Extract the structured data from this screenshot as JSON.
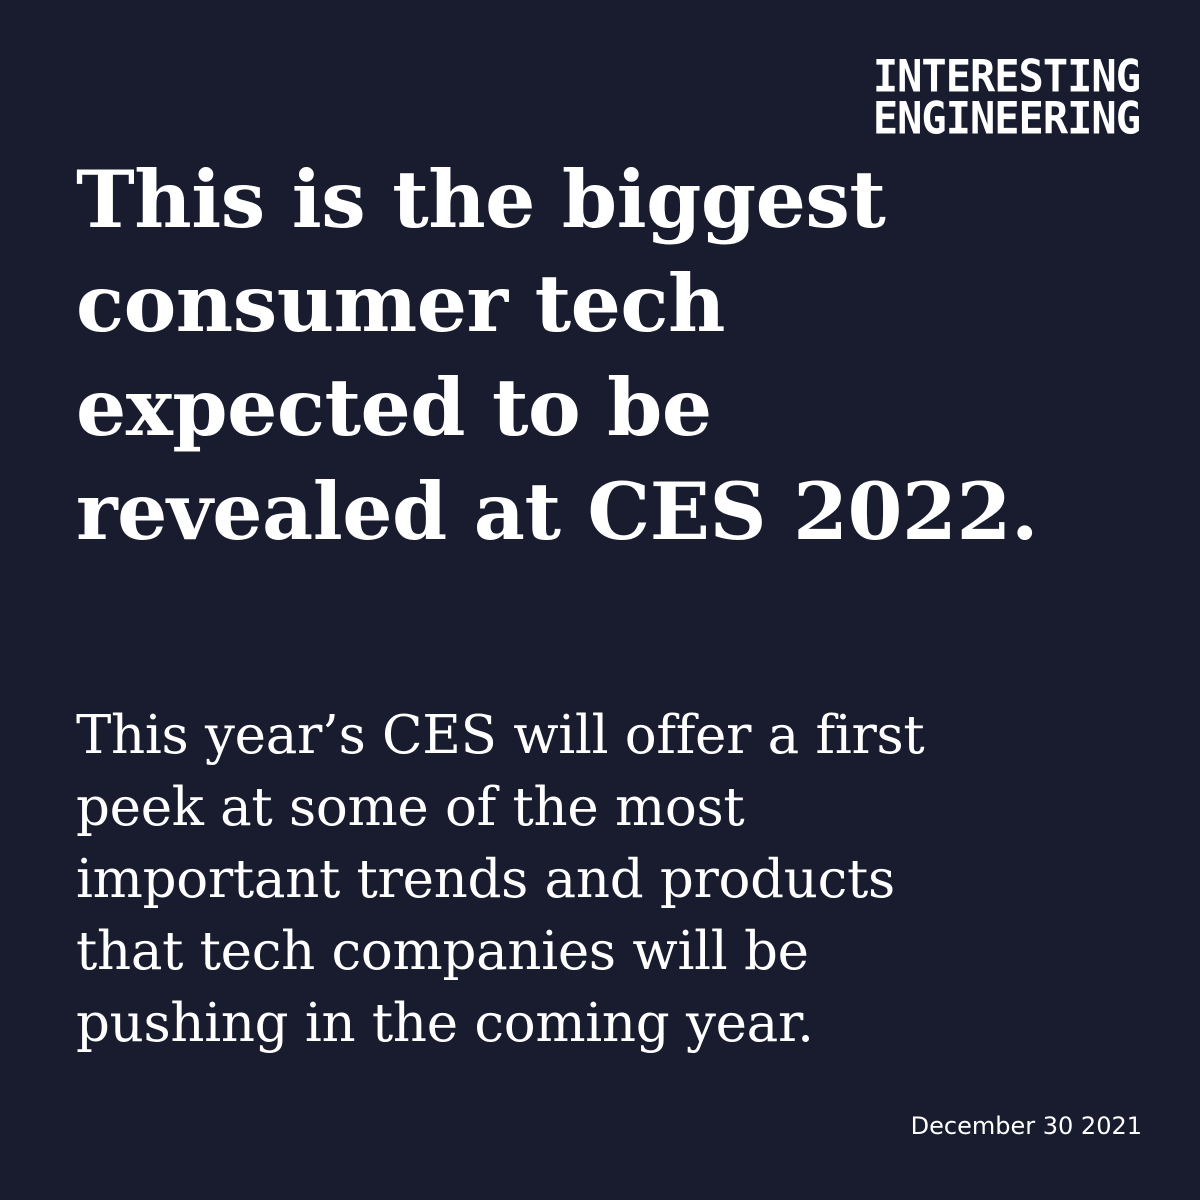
{
  "brand": {
    "logo_lines": [
      "INTERESTING",
      "ENGINEERING"
    ]
  },
  "headline": {
    "lines": [
      "This is the biggest",
      "consumer tech",
      "expected to be",
      "revealed at CES 2022."
    ]
  },
  "summary": {
    "lines": [
      "This year’s CES will offer a first",
      "peek at some of the most",
      "important trends and products",
      "that tech companies will be",
      "pushing in the coming year."
    ]
  },
  "date": "December 30 2021",
  "colors": {
    "background": "#181c2e",
    "text": "#ffffff"
  }
}
